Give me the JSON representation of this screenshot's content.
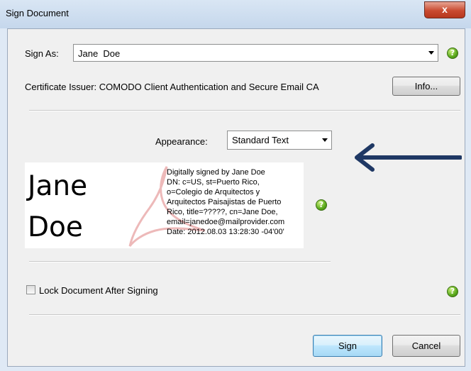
{
  "window": {
    "title": "Sign Document",
    "close_glyph": "x"
  },
  "sign_as": {
    "label": "Sign As:",
    "value": "Jane  Doe"
  },
  "certificate": {
    "text": "Certificate Issuer: COMODO Client Authentication and Secure Email CA",
    "info_button": "Info..."
  },
  "appearance": {
    "label": "Appearance:",
    "value": "Standard Text"
  },
  "preview": {
    "name_line1": "Jane",
    "name_line2": "Doe",
    "details": [
      "Digitally signed by Jane  Doe",
      "DN: c=US, st=Puerto Rico,",
      "o=Colegio de Arquitectos y",
      "Arquitectos Paisajistas de Puerto",
      "Rico, title=?????, cn=Jane  Doe,",
      "email=janedoe@mailprovider.com",
      "Date: 2012.08.03 13:28:30 -04'00'"
    ]
  },
  "lock": {
    "label": "Lock Document After Signing",
    "checked": false
  },
  "buttons": {
    "sign": "Sign",
    "cancel": "Cancel"
  },
  "help_glyph": "?",
  "colors": {
    "arrow": "#1f3864",
    "help": "#5aa91c",
    "watermark": "#e8a7a7"
  }
}
